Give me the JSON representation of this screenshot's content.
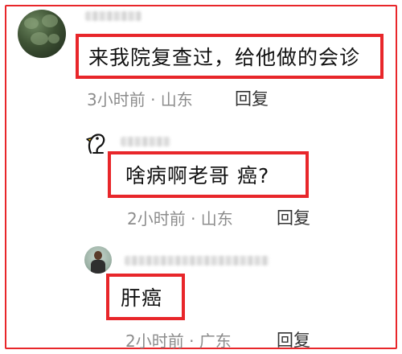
{
  "comments": [
    {
      "text": "来我院复查过，给他做的会诊",
      "time_location": "3小时前 · 山东",
      "reply_label": "回复"
    },
    {
      "text": "啥病啊老哥 癌?",
      "time_location": "2小时前 · 山东",
      "reply_label": "回复"
    },
    {
      "text": "肝癌",
      "time_location": "2小时前 · 广东",
      "reply_label": "回复"
    }
  ],
  "colors": {
    "highlight_border": "#e8262a",
    "meta_text": "#8c8c8c",
    "body_text": "#111111"
  },
  "icons": [
    "user-avatar",
    "duck-avatar",
    "user-avatar"
  ]
}
